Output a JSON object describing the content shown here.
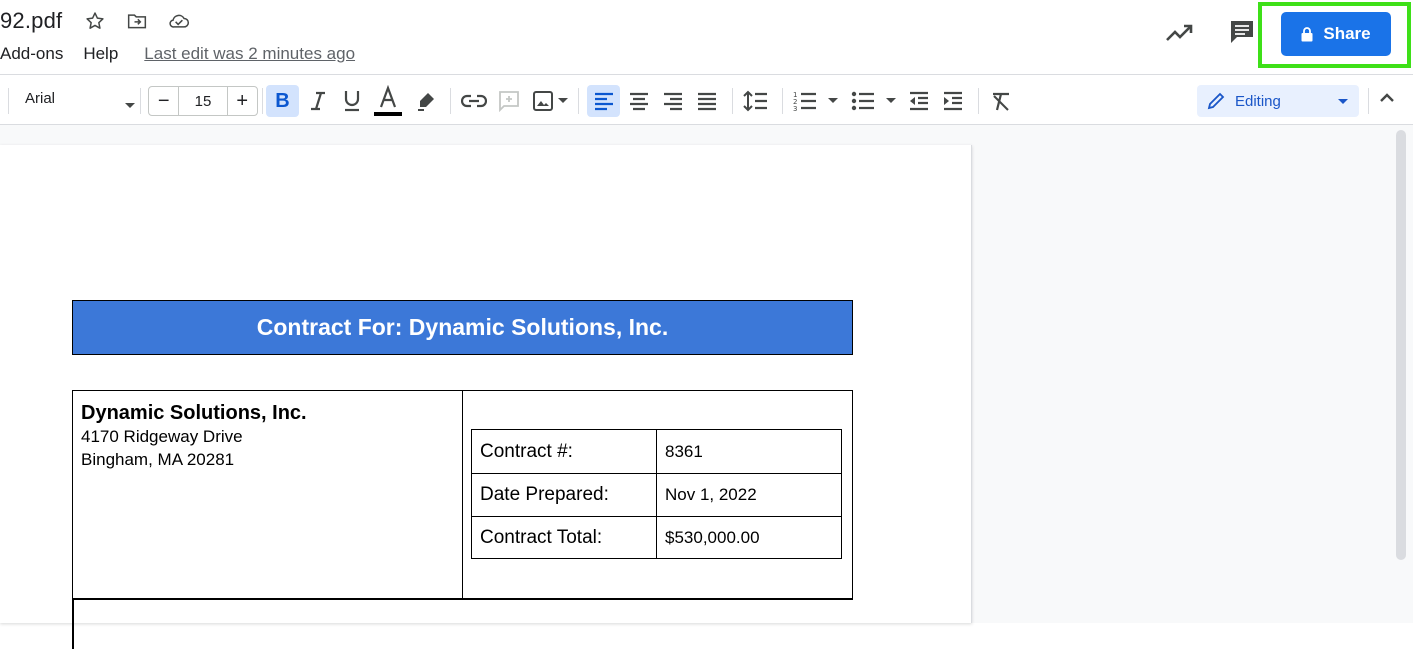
{
  "header": {
    "doc_title": "92.pdf",
    "menu": [
      "Add-ons",
      "Help"
    ],
    "last_edit": "Last edit was 2 minutes ago",
    "share_label": "Share"
  },
  "toolbar": {
    "font": "Arial",
    "font_size": "15",
    "minus": "−",
    "plus": "+",
    "bold": "B",
    "mode": "Editing"
  },
  "document": {
    "banner_title": "Contract For: Dynamic Solutions, Inc.",
    "company_name": "Dynamic Solutions, Inc.",
    "address_line1": "4170 Ridgeway Drive",
    "address_line2": "Bingham, MA 20281",
    "details": [
      {
        "label": "Contract #:",
        "value": "8361"
      },
      {
        "label": "Date Prepared:",
        "value": "Nov 1, 2022"
      },
      {
        "label": "Contract Total:",
        "value": "$530,000.00"
      }
    ]
  },
  "colors": {
    "share_blue": "#1a73e8",
    "highlight_green": "#3ee018",
    "banner_blue": "#3c78d8"
  }
}
